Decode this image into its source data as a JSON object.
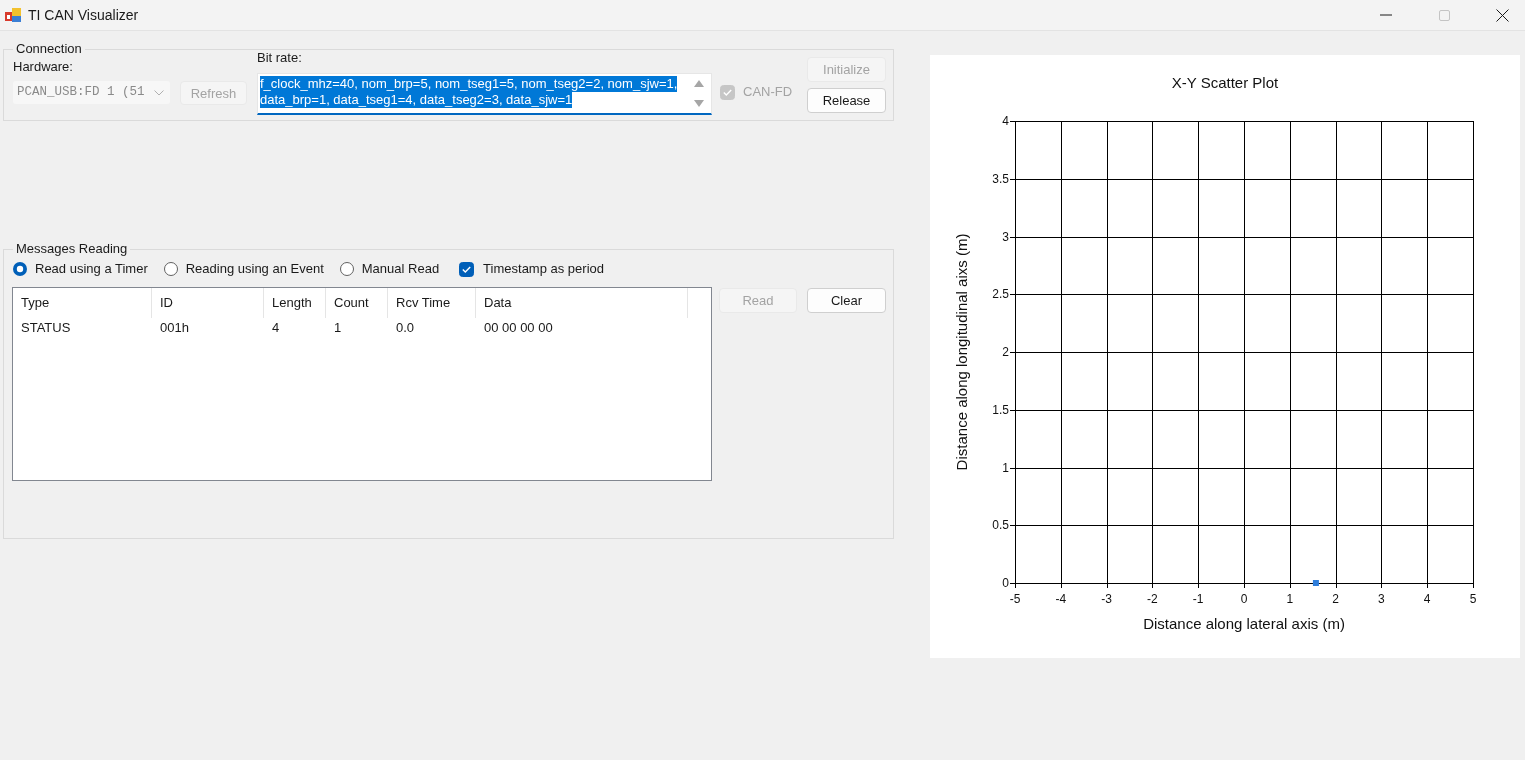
{
  "window": {
    "title": "TI CAN Visualizer",
    "controls": [
      {
        "kind": "minimize",
        "disabled": false
      },
      {
        "kind": "maximize",
        "disabled": true
      },
      {
        "kind": "close",
        "disabled": false
      }
    ]
  },
  "connection": {
    "title": "Connection",
    "hardware": {
      "label": "Hardware:",
      "value": "PCAN_USB:FD 1 (51",
      "disabled": true
    },
    "refresh_button": {
      "label": "Refresh",
      "disabled": true
    },
    "bit_rate": {
      "label": "Bit rate:",
      "lines": [
        "f_clock_mhz=40, nom_brp=5, nom_tseg1=5, nom_tseg2=2, nom_sjw=1,",
        "data_brp=1, data_tseg1=4, data_tseg2=3, data_sjw=1"
      ],
      "highlighted": true
    },
    "can_fd": {
      "label": "CAN-FD",
      "checked": true,
      "disabled": true
    },
    "buttons": [
      {
        "label": "Initialize",
        "disabled": true
      },
      {
        "label": "Release",
        "disabled": false
      }
    ]
  },
  "messages_reading": {
    "title": "Messages Reading",
    "options": [
      {
        "kind": "radio",
        "label": "Read using a Timer",
        "selected": true
      },
      {
        "kind": "radio",
        "label": "Reading using an Event",
        "selected": false
      },
      {
        "kind": "radio",
        "label": "Manual Read",
        "selected": false
      },
      {
        "kind": "checkbox",
        "label": "Timestamp as period",
        "checked": true
      }
    ],
    "table": {
      "columns": [
        "Type",
        "ID",
        "Length",
        "Count",
        "Rcv Time",
        "Data"
      ],
      "rows": [
        [
          "STATUS",
          "001h",
          "4",
          "1",
          "0.0",
          "00 00 00 00"
        ]
      ]
    },
    "buttons": [
      {
        "label": "Read",
        "disabled": true
      },
      {
        "label": "Clear",
        "disabled": false
      }
    ]
  },
  "chart": {
    "chart_data": {
      "type": "scatter",
      "title": "X-Y Scatter Plot",
      "xlabel": "Distance along lateral axis (m)",
      "ylabel": "Distance along longitudinal aixs (m)",
      "x": [
        1.57
      ],
      "series": [
        {
          "color": "#2e7ddb",
          "values": [
            0
          ]
        }
      ],
      "xlim": [
        -5,
        5
      ],
      "ylim": [
        0,
        4
      ],
      "xticks": [
        -5,
        -4,
        -3,
        -2,
        -1,
        0,
        1,
        2,
        3,
        4,
        5
      ],
      "yticks": [
        0,
        0.5,
        1,
        1.5,
        2,
        2.5,
        3,
        3.5,
        4
      ],
      "grid": true
    }
  }
}
